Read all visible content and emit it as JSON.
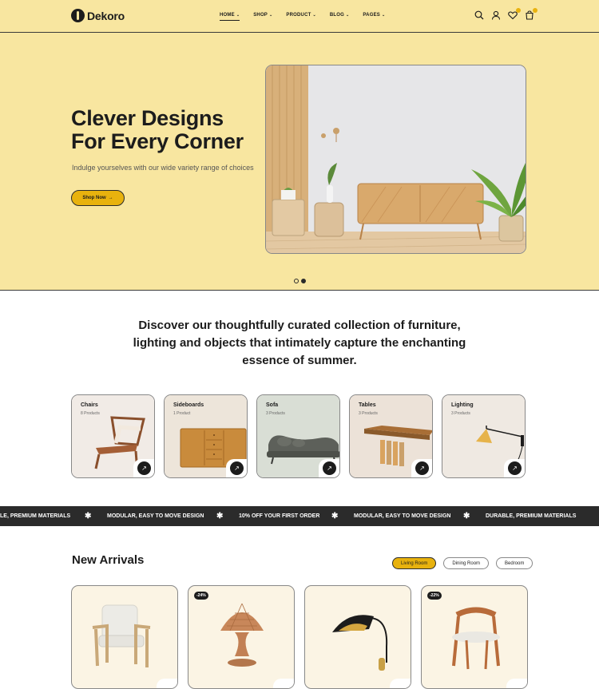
{
  "brand": {
    "name": "Dekoro"
  },
  "nav": [
    {
      "label": "Home",
      "active": true
    },
    {
      "label": "Shop"
    },
    {
      "label": "Product"
    },
    {
      "label": "Blog"
    },
    {
      "label": "Pages"
    }
  ],
  "header_icons": [
    "search-icon",
    "user-icon",
    "heart-icon",
    "cart-icon"
  ],
  "hero": {
    "title_line1": "Clever Designs",
    "title_line2": "For Every Corner",
    "subtitle": "Indulge yourselves with our wide variety range of choices",
    "button_label": "Shop Now",
    "slides_total": 2,
    "slide_active": 2
  },
  "intro": {
    "text": "Discover our thoughtfully curated collection of furniture, lighting and objects that intimately capture the enchanting essence of summer."
  },
  "categories": [
    {
      "name": "Chairs",
      "count": "8 Products",
      "bg": "#f1ebe6"
    },
    {
      "name": "Sideboards",
      "count": "1 Product",
      "bg": "#ede5da"
    },
    {
      "name": "Sofa",
      "count": "3 Products",
      "bg": "#d9ded5"
    },
    {
      "name": "Tables",
      "count": "3 Products",
      "bg": "#ece2d8"
    },
    {
      "name": "Lighting",
      "count": "3 Products",
      "bg": "#efe9e2"
    }
  ],
  "marquee": {
    "items": [
      "LE, PREMIUM MATERIALS",
      "MODULAR, EASY TO MOVE DESIGN",
      "10% OFF YOUR FIRST ORDER",
      "MODULAR, EASY TO MOVE DESIGN",
      "DURABLE, PREMIUM MATERIALS"
    ]
  },
  "new_arrivals": {
    "title": "New Arrivals",
    "tabs": [
      {
        "label": "Living Room",
        "active": true
      },
      {
        "label": "Dining Room"
      },
      {
        "label": "Bedroom"
      }
    ],
    "products": [
      {
        "badge": ""
      },
      {
        "badge": "-24%"
      },
      {
        "badge": ""
      },
      {
        "badge": "-22%"
      }
    ]
  },
  "colors": {
    "accent": "#e8b20e",
    "hero_bg": "#f8e6a0",
    "dark": "#2b2b2b"
  }
}
